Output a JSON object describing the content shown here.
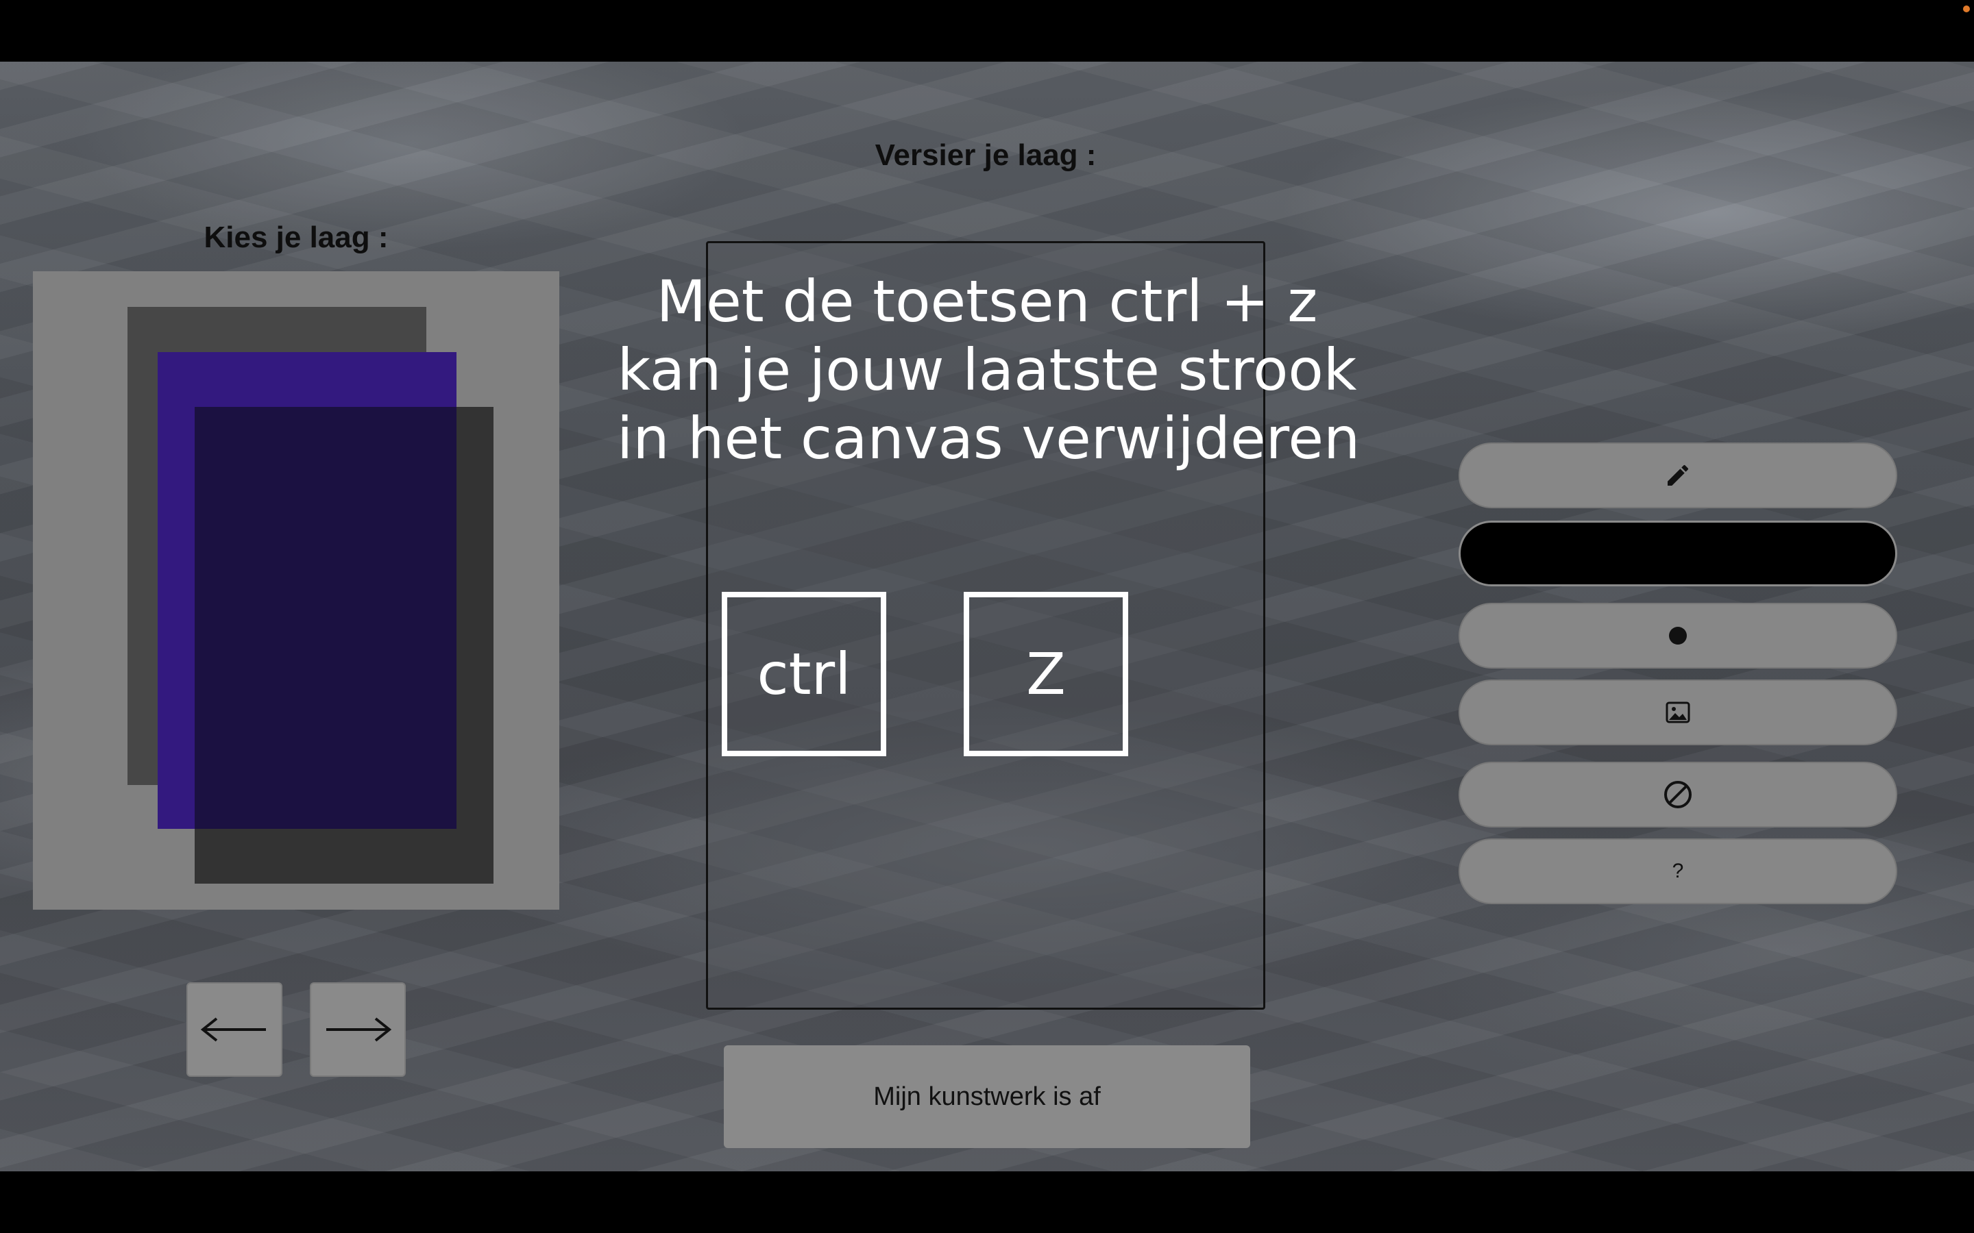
{
  "headings": {
    "layers": "Kies je laag :",
    "decorate": "Versier je laag :"
  },
  "layers": {
    "colors": {
      "back": "#474747",
      "selected": "#33197f",
      "front": "#282828"
    },
    "prev_icon": "arrow-left-icon",
    "next_icon": "arrow-right-icon"
  },
  "overlay": {
    "lines": [
      "Met de toetsen ctrl + z",
      "kan je jouw laatste strook",
      "in het canvas verwijderen"
    ],
    "keys": [
      "ctrl",
      "Z"
    ]
  },
  "finish_button": "Mijn kunstwerk is af",
  "tools": {
    "pencil_icon": "pencil-icon",
    "current_color": "#000000",
    "brush_icon": "brush-size-dot-icon",
    "image_icon": "image-icon",
    "clear_icon": "no-sign-icon",
    "help_label": "?"
  }
}
